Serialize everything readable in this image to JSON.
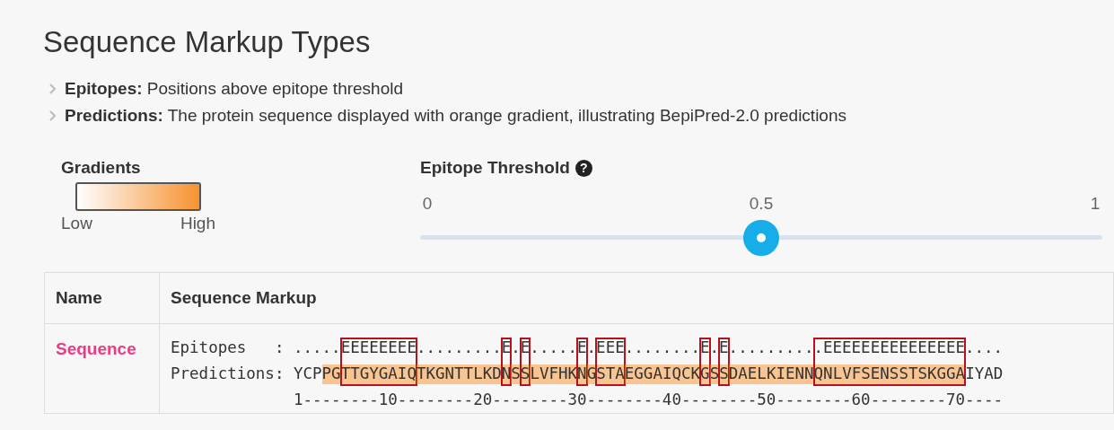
{
  "title": "Sequence Markup Types",
  "legend": [
    {
      "term": "Epitopes:",
      "text": "Positions above epitope threshold"
    },
    {
      "term": "Predictions:",
      "text": "The protein sequence displayed with orange gradient, illustrating BepiPred-2.0 predictions"
    }
  ],
  "gradients": {
    "title": "Gradients",
    "low": "Low",
    "high": "High"
  },
  "threshold": {
    "title": "Epitope Threshold",
    "help": "?",
    "ticks": [
      "0",
      "0.5",
      "1"
    ],
    "level": 0.5
  },
  "table": {
    "columns": [
      "Name",
      "Sequence Markup"
    ],
    "rows": [
      {
        "name": "Sequence",
        "lines": [
          {
            "kind": "epitopes",
            "label": "Epitopes   :",
            "text": ".....EEEEEEEE.........E.E.....E.EEE........E.E..........EEEEEEEEEEEEEEE...."
          },
          {
            "kind": "predictions",
            "label": "Predictions:",
            "segments": [
              {
                "text": "YCP",
                "shaded": false,
                "boxed": false
              },
              {
                "text": "PG",
                "shaded": true,
                "boxed": false
              },
              {
                "text": "TTGYGAIQ",
                "shaded": true,
                "boxed": true
              },
              {
                "text": "TKGNTTLKD",
                "shaded": true,
                "boxed": false
              },
              {
                "text": "N",
                "shaded": true,
                "boxed": true
              },
              {
                "text": "S",
                "shaded": true,
                "boxed": false
              },
              {
                "text": "S",
                "shaded": true,
                "boxed": true
              },
              {
                "text": "LVFHK",
                "shaded": true,
                "boxed": false
              },
              {
                "text": "N",
                "shaded": true,
                "boxed": true
              },
              {
                "text": "G",
                "shaded": true,
                "boxed": false
              },
              {
                "text": "STA",
                "shaded": true,
                "boxed": true
              },
              {
                "text": "EGGAIQCK",
                "shaded": true,
                "boxed": false
              },
              {
                "text": "G",
                "shaded": true,
                "boxed": true
              },
              {
                "text": "S",
                "shaded": true,
                "boxed": false
              },
              {
                "text": "S",
                "shaded": true,
                "boxed": true
              },
              {
                "text": "DAELKIENN",
                "shaded": true,
                "boxed": false
              },
              {
                "text": "QNLVFSENSSTSKGGA",
                "shaded": true,
                "boxed": true
              },
              {
                "text": "IYAD",
                "shaded": false,
                "boxed": false
              }
            ]
          },
          {
            "kind": "ruler",
            "text": "1--------10--------20--------30--------40--------50--------60--------70----"
          }
        ]
      }
    ]
  }
}
